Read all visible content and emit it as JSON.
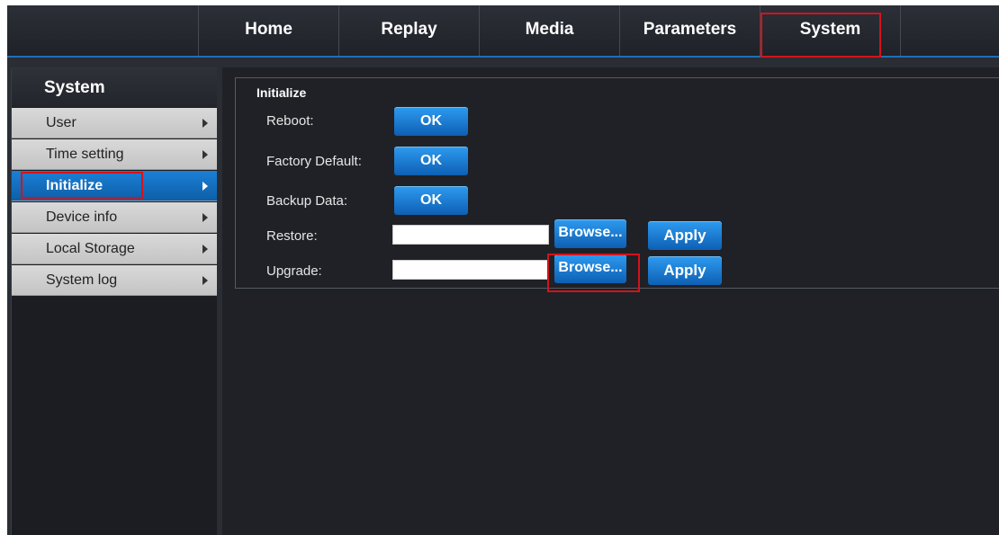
{
  "nav": {
    "tabs": [
      {
        "label": "Home"
      },
      {
        "label": "Replay"
      },
      {
        "label": "Media"
      },
      {
        "label": "Parameters"
      },
      {
        "label": "System"
      }
    ],
    "active": "System"
  },
  "sidebar": {
    "title": "System",
    "items": [
      {
        "label": "User"
      },
      {
        "label": "Time setting"
      },
      {
        "label": "Initialize"
      },
      {
        "label": "Device info"
      },
      {
        "label": "Local Storage"
      },
      {
        "label": "System log"
      }
    ],
    "active": "Initialize"
  },
  "panel": {
    "title": "Initialize",
    "reboot": {
      "label": "Reboot:",
      "button": "OK"
    },
    "factory_default": {
      "label": "Factory Default:",
      "button": "OK"
    },
    "backup_data": {
      "label": "Backup Data:",
      "button": "OK"
    },
    "restore": {
      "label": "Restore:",
      "value": "",
      "browse": "Browse...",
      "apply": "Apply"
    },
    "upgrade": {
      "label": "Upgrade:",
      "value": "",
      "browse": "Browse...",
      "apply": "Apply"
    }
  },
  "colors": {
    "accent": "#1d6fb8",
    "highlight": "#d5121b",
    "button": "#1a7fd4"
  },
  "icons": {
    "sidebar_chevron": "chevron-right-icon"
  }
}
